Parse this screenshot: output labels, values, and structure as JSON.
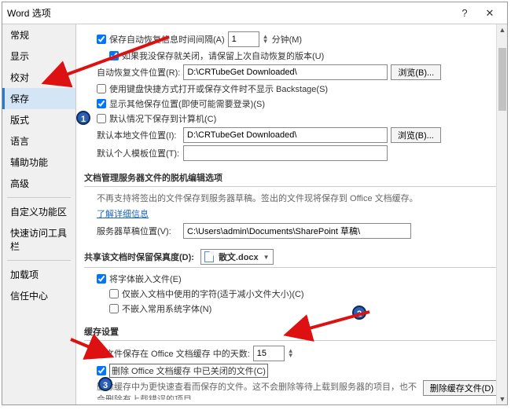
{
  "titlebar": {
    "title": "Word 选项"
  },
  "sidebar": {
    "items": [
      {
        "label": "常规"
      },
      {
        "label": "显示"
      },
      {
        "label": "校对"
      },
      {
        "label": "保存"
      },
      {
        "label": "版式"
      },
      {
        "label": "语言"
      },
      {
        "label": "辅助功能"
      },
      {
        "label": "高级"
      }
    ],
    "group2": [
      {
        "label": "自定义功能区"
      },
      {
        "label": "快速访问工具栏"
      }
    ],
    "group3": [
      {
        "label": "加载项"
      },
      {
        "label": "信任中心"
      }
    ]
  },
  "content": {
    "autosave": {
      "chk1": "保存自动恢复信息时间间隔(A)",
      "interval": "1",
      "minutes": "分钟(M)",
      "chk2": "如果我没保存就关闭，请保留上次自动恢复的版本(U)",
      "loc_label": "自动恢复文件位置(R):",
      "loc_value": "D:\\CRTubeGet Downloaded\\",
      "browse": "浏览(B)...",
      "chk3": "使用键盘快捷方式打开或保存文件时不显示 Backstage(S)",
      "chk4": "显示其他保存位置(即使可能需要登录)(S)",
      "chk5": "默认情况下保存到计算机(C)",
      "def_loc_label": "默认本地文件位置(I):",
      "def_loc_value": "D:\\CRTubeGet Downloaded\\",
      "tmpl_label": "默认个人模板位置(T):",
      "tmpl_value": ""
    },
    "mgmt": {
      "header": "文档管理服务器文件的脱机编辑选项",
      "note": "不再支持将签出的文件保存到服务器草稿。签出的文件现将保存到 Office 文档缓存。",
      "link": "了解详细信息",
      "draft_label": "服务器草稿位置(V):",
      "draft_value": "C:\\Users\\admin\\Documents\\SharePoint 草稿\\"
    },
    "share": {
      "header": "共享该文档时保留保真度(D):",
      "doc": "散文.docx",
      "chk1": "将字体嵌入文件(E)",
      "chk2": "仅嵌入文档中使用的字符(适于减小文件大小)(C)",
      "chk3": "不嵌入常用系统字体(N)"
    },
    "cache": {
      "header": "缓存设置",
      "days_label": "将文件保存在 Office 文档缓存 中的天数:",
      "days_value": "15",
      "del_chk": "删除 Office 文档缓存 中已关闭的文件(C)",
      "note": "删除缓存中为更快速查看而保存的文件。这不会删除等待上载到服务器的项目，也不会删除有上载错误的项目。",
      "del_btn": "删除缓存文件(D)"
    }
  },
  "annotations": {
    "one": "1",
    "two": "2",
    "three": "3"
  }
}
